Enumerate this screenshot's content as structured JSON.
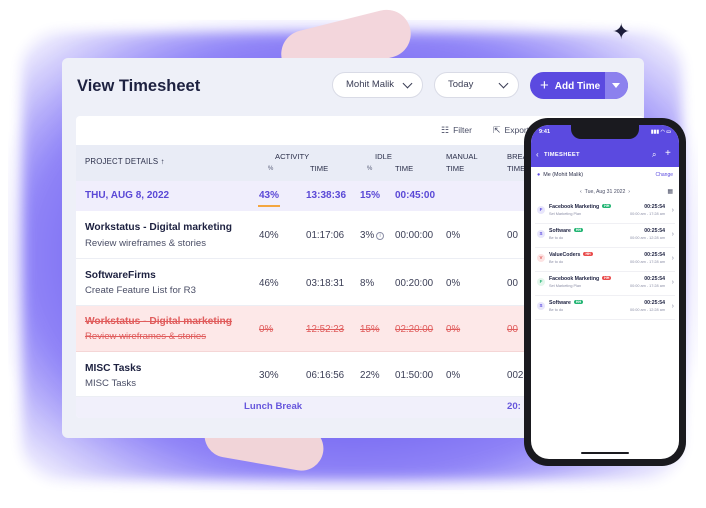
{
  "page": {
    "title": "View Timesheet",
    "user_select": "Mohit Malik",
    "day_select": "Today",
    "add_button": "Add Time"
  },
  "toolbar": {
    "filter": "Filter",
    "export": "Export"
  },
  "table": {
    "headers": {
      "project": "PROJECT DETAILS",
      "project_sort": "↑",
      "activity": "ACTIVITY",
      "activity_pct": "%",
      "activity_time": "TIME",
      "idle": "IDLE",
      "idle_pct": "%",
      "idle_time": "TIME",
      "manual": "MANUAL",
      "manual_time": "TIME",
      "break": "BREA",
      "break_time": "TIME"
    },
    "date_row": {
      "date": "THU, AUG 8, 2022",
      "activity_pct": "43%",
      "activity_time": "13:38:36",
      "idle_pct": "15%",
      "idle_time": "00:45:00"
    },
    "rows": [
      {
        "name": "Workstatus - Digital marketing",
        "task": "Review wireframes & stories",
        "activity_pct": "40%",
        "activity_time": "01:17:06",
        "idle_pct": "3%",
        "idle_time": "00:00:00",
        "manual": "0%",
        "break": "00"
      },
      {
        "name": "SoftwareFirms",
        "task": "Create Feature List for R3",
        "activity_pct": "46%",
        "activity_time": "03:18:31",
        "idle_pct": "8%",
        "idle_time": "00:20:00",
        "manual": "0%",
        "break": "00"
      },
      {
        "name": "Workstatus - Digital marketing",
        "task": "Review wireframes & stories",
        "activity_pct": "0%",
        "activity_time": "12:52:23",
        "idle_pct": "15%",
        "idle_time": "02:20:00",
        "manual": "0%",
        "break": "00"
      },
      {
        "name": "MISC Tasks",
        "task": "MISC Tasks",
        "activity_pct": "30%",
        "activity_time": "06:16:56",
        "idle_pct": "22%",
        "idle_time": "01:50:00",
        "manual": "0%",
        "break": "002"
      }
    ],
    "lunch_row": {
      "label": "Lunch Break",
      "break_time": "20:"
    }
  },
  "phone": {
    "time": "9:41",
    "title": "TIMESHEET",
    "me_label": "Me (Mohit Malik)",
    "change": "Change",
    "date": "Tue, Aug 31 2022",
    "entries": [
      {
        "initial": "F",
        "name": "Facebook Marketing",
        "badge": "HH",
        "badge_color": "#22b573",
        "sub": "Set Marketing Plan",
        "duration": "00:25:54",
        "range": "00:00 am - 17:28 am"
      },
      {
        "initial": "S",
        "name": "Software",
        "badge": "HH",
        "badge_color": "#22b573",
        "sub": "Be to do",
        "duration": "00:25:54",
        "range": "00:00 am - 12:28 am"
      },
      {
        "initial": "V",
        "name": "ValueCoders",
        "badge": "HH",
        "badge_color": "#e94b4b",
        "sub": "Be to do",
        "duration": "00:25:54",
        "range": "00:00 am - 17:28 am"
      },
      {
        "initial": "F",
        "name": "Facebook Marketing",
        "badge": "HH",
        "badge_color": "#e94b4b",
        "sub": "Set Marketing Plan",
        "duration": "00:25:54",
        "range": "00:00 am - 17:28 am"
      },
      {
        "initial": "S",
        "name": "Software",
        "badge": "HH",
        "badge_color": "#22b573",
        "sub": "Be to do",
        "duration": "00:25:54",
        "range": "00:00 am - 12:28 am"
      }
    ]
  },
  "colors": {
    "accent": "#5b4ae0",
    "deleted_row": "#fde8e8",
    "deleted_text": "#e05c5c",
    "underline": "#f4a640"
  }
}
